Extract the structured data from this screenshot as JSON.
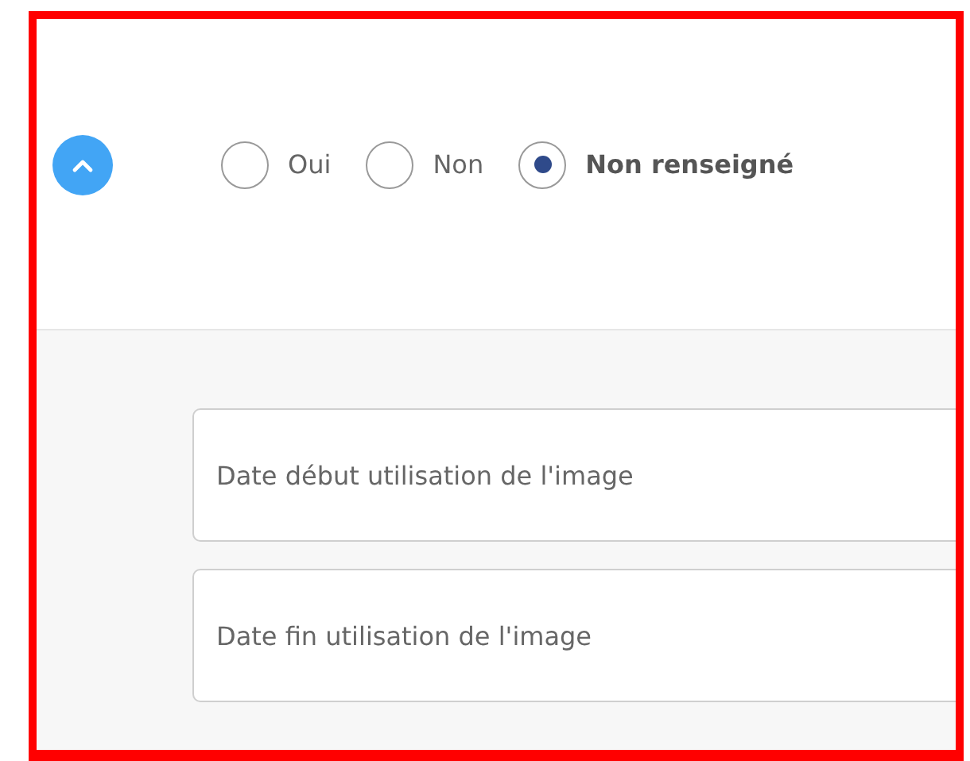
{
  "toggle": {
    "expanded": true
  },
  "radios": [
    {
      "label": "Oui",
      "selected": false
    },
    {
      "label": "Non",
      "selected": false
    },
    {
      "label": "Non renseigné",
      "selected": true
    }
  ],
  "fields": [
    {
      "placeholder": "Date début utilisation de l'image"
    },
    {
      "placeholder": "Date fin utilisation de l'image"
    }
  ]
}
